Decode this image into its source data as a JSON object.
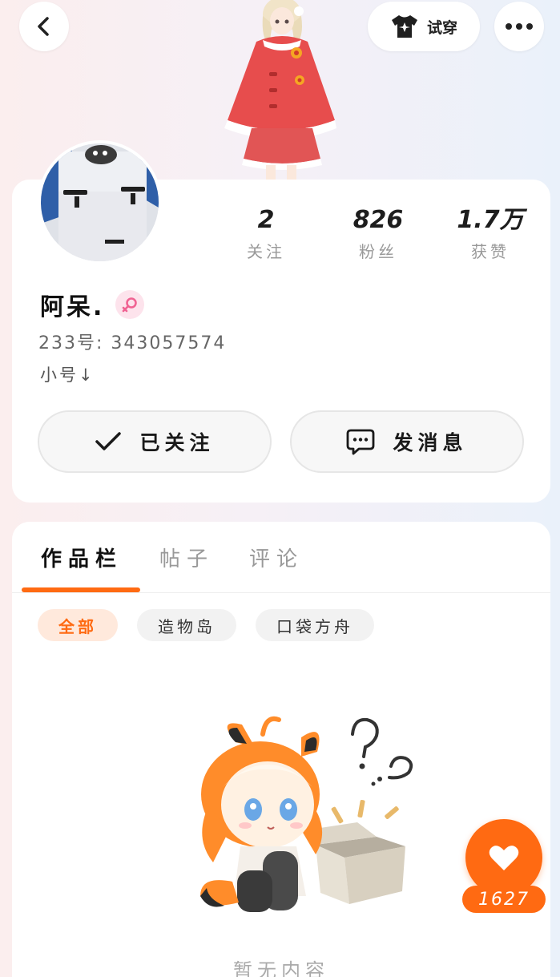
{
  "header": {
    "try_on_label": "试穿"
  },
  "profile": {
    "stats": [
      {
        "value": "2",
        "label": "关注"
      },
      {
        "value": "826",
        "label": "粉丝"
      },
      {
        "value": "1.7万",
        "label": "获赞"
      }
    ],
    "username": "阿呆.",
    "uid": "233号: 343057574",
    "bio": "小号↓",
    "follow_button": "已关注",
    "message_button": "发消息"
  },
  "content": {
    "tabs": [
      {
        "label": "作品栏",
        "active": true
      },
      {
        "label": "帖子",
        "active": false
      },
      {
        "label": "评论",
        "active": false
      }
    ],
    "filters": [
      {
        "label": "全部",
        "active": true
      },
      {
        "label": "造物岛",
        "active": false
      },
      {
        "label": "口袋方舟",
        "active": false
      }
    ],
    "empty_text": "暂无内容"
  },
  "like": {
    "count": "1627"
  },
  "colors": {
    "accent": "#ff6a12",
    "gender_female": "#f06292"
  }
}
